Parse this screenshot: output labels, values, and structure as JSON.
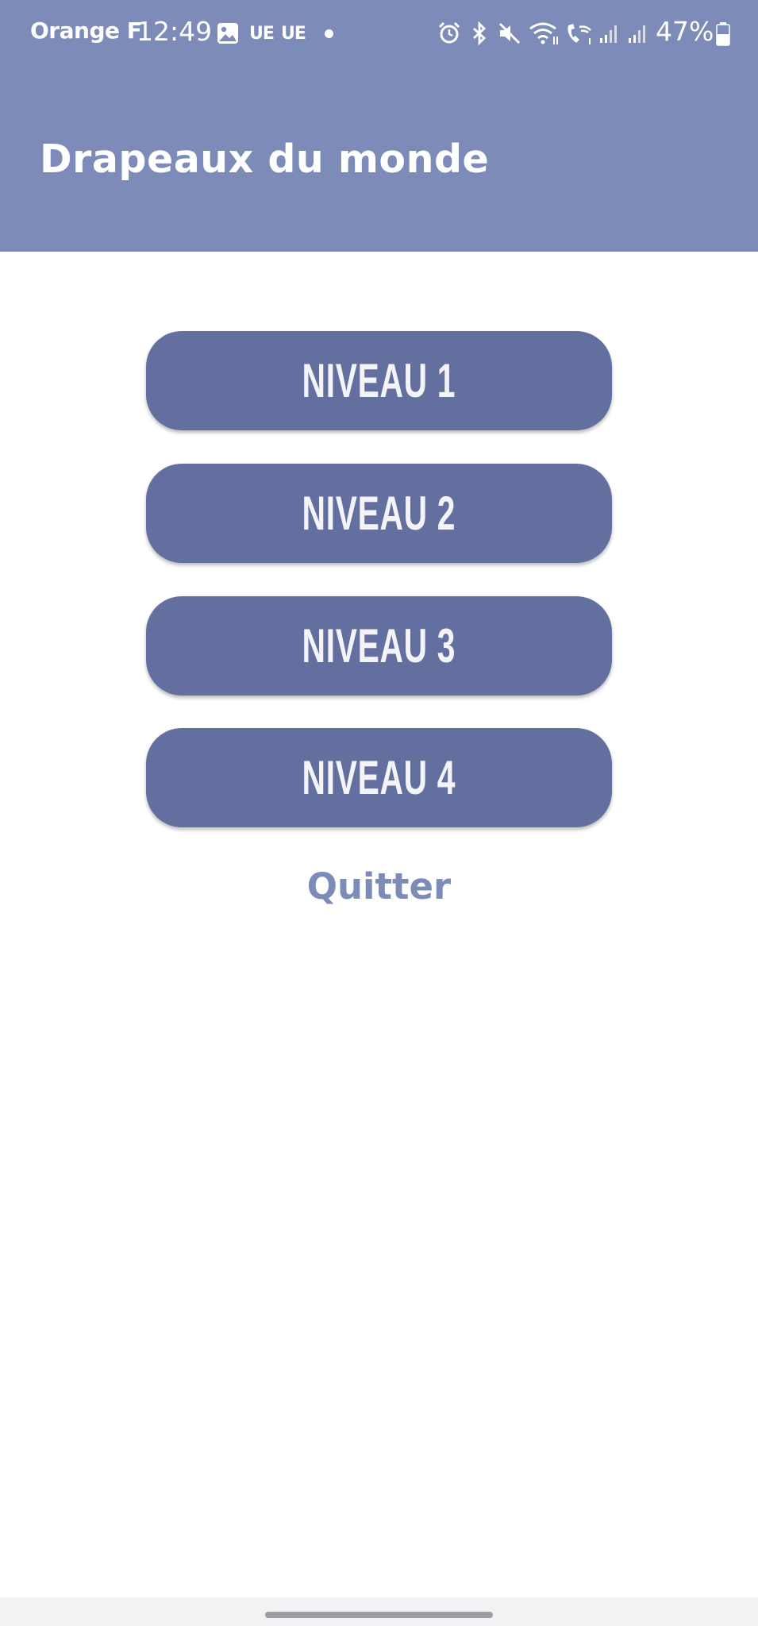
{
  "status_bar": {
    "carrier": "Orange F",
    "time": "12:49",
    "network_1": "UE",
    "network_2": "UE",
    "battery": "47%",
    "icons": [
      "image-icon",
      "alarm-icon",
      "bluetooth-icon",
      "mute-icon",
      "wifi-icon",
      "wifi-call-icon",
      "signal-icon",
      "signal-icon"
    ]
  },
  "app_bar": {
    "title": "Drapeaux du monde",
    "color": "#7d8bb8"
  },
  "levels": [
    {
      "label": "NIVEAU 1"
    },
    {
      "label": "NIVEAU 2"
    },
    {
      "label": "NIVEAU 3"
    },
    {
      "label": "NIVEAU 4"
    }
  ],
  "quit_label": "Quitter",
  "colors": {
    "button": "#636f9f",
    "accent": "#7d8bb8"
  }
}
